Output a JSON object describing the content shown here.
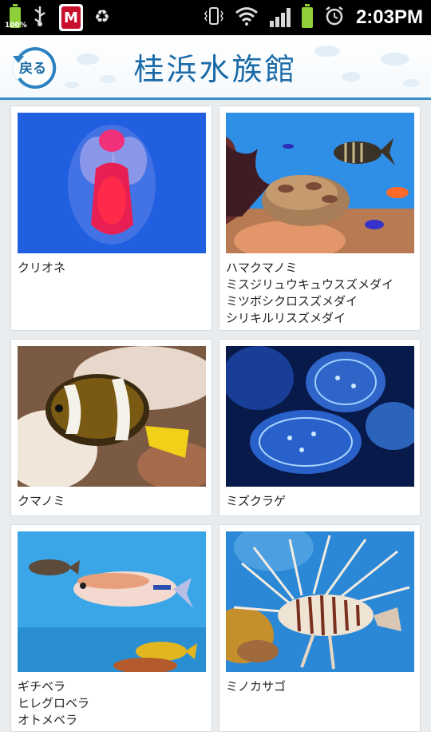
{
  "status_bar": {
    "battery_percent_label": "100%",
    "time": "2:03PM",
    "icons": [
      "battery-icon",
      "usb-icon",
      "mcafee-shield-icon",
      "recycle-icon",
      "vibrate-icon",
      "wifi-icon",
      "signal-icon",
      "battery-icon",
      "alarm-icon"
    ]
  },
  "header": {
    "back_label": "戻る",
    "title": "桂浜水族館"
  },
  "cards": [
    {
      "caption": "クリオネ",
      "image": "clione-photo"
    },
    {
      "caption": "ハマクマノミ\nミスジリュウキュウスズメダイ\nミツボシクロスズメダイ\nシリキルリスズメダイ",
      "image": "coral-reef-photo"
    },
    {
      "caption": "クマノミ",
      "image": "clownfish-photo"
    },
    {
      "caption": "ミズクラゲ",
      "image": "jellyfish-photo"
    },
    {
      "caption": "ギチベラ\nヒレグロベラ\nオトメベラ",
      "image": "wrasse-photo"
    },
    {
      "caption": "ミノカサゴ",
      "image": "lionfish-photo"
    }
  ],
  "colors": {
    "accent": "#1a6aa8",
    "header_border": "#3a8fc7",
    "background": "#e9ecef"
  }
}
